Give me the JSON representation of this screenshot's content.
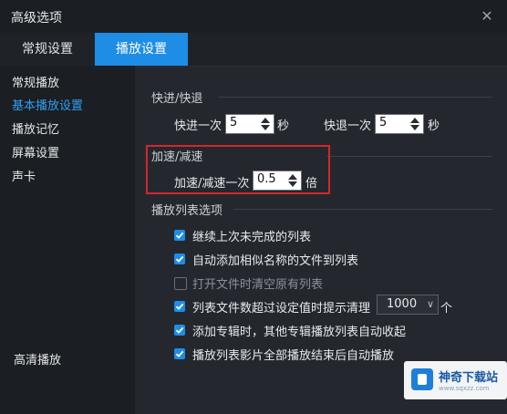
{
  "window": {
    "title": "高级选项",
    "close_glyph": "✕"
  },
  "tabs": [
    {
      "label": "常规设置",
      "active": false
    },
    {
      "label": "播放设置",
      "active": true
    }
  ],
  "sidebar": {
    "items": [
      {
        "label": "常规播放",
        "active": false
      },
      {
        "label": "基本播放设置",
        "active": true
      },
      {
        "label": "播放记忆",
        "active": false
      },
      {
        "label": "屏幕设置",
        "active": false
      },
      {
        "label": "声卡",
        "active": false
      }
    ],
    "bottom_item": "高清播放"
  },
  "seek": {
    "section_title": "快进/快退",
    "forward_label": "快进一次",
    "forward_value": "5",
    "forward_unit": "秒",
    "backward_label": "快退一次",
    "backward_value": "5",
    "backward_unit": "秒"
  },
  "speed": {
    "section_title": "加速/减速",
    "label": "加速/减速一次",
    "value": "0.5",
    "unit": "倍"
  },
  "playlist": {
    "section_title": "播放列表选项",
    "options": [
      {
        "label": "继续上次未完成的列表",
        "checked": true
      },
      {
        "label": "自动添加相似名称的文件到列表",
        "checked": true
      },
      {
        "label": "打开文件时清空原有列表",
        "checked": false
      },
      {
        "label": "列表文件数超过设定值时提示清理",
        "checked": true
      },
      {
        "label": "添加专辑时，其他专辑播放列表自动收起",
        "checked": true
      },
      {
        "label": "播放列表影片全部播放结束后自动播放",
        "checked": true
      }
    ],
    "limit_value": "1000",
    "limit_unit": "个"
  },
  "watermark": {
    "title": "神奇下载站",
    "subtitle": "www.sqxzz.com"
  },
  "colors": {
    "accent": "#1e8de6",
    "highlight_box": "#d3262c",
    "background": "#24282e"
  }
}
